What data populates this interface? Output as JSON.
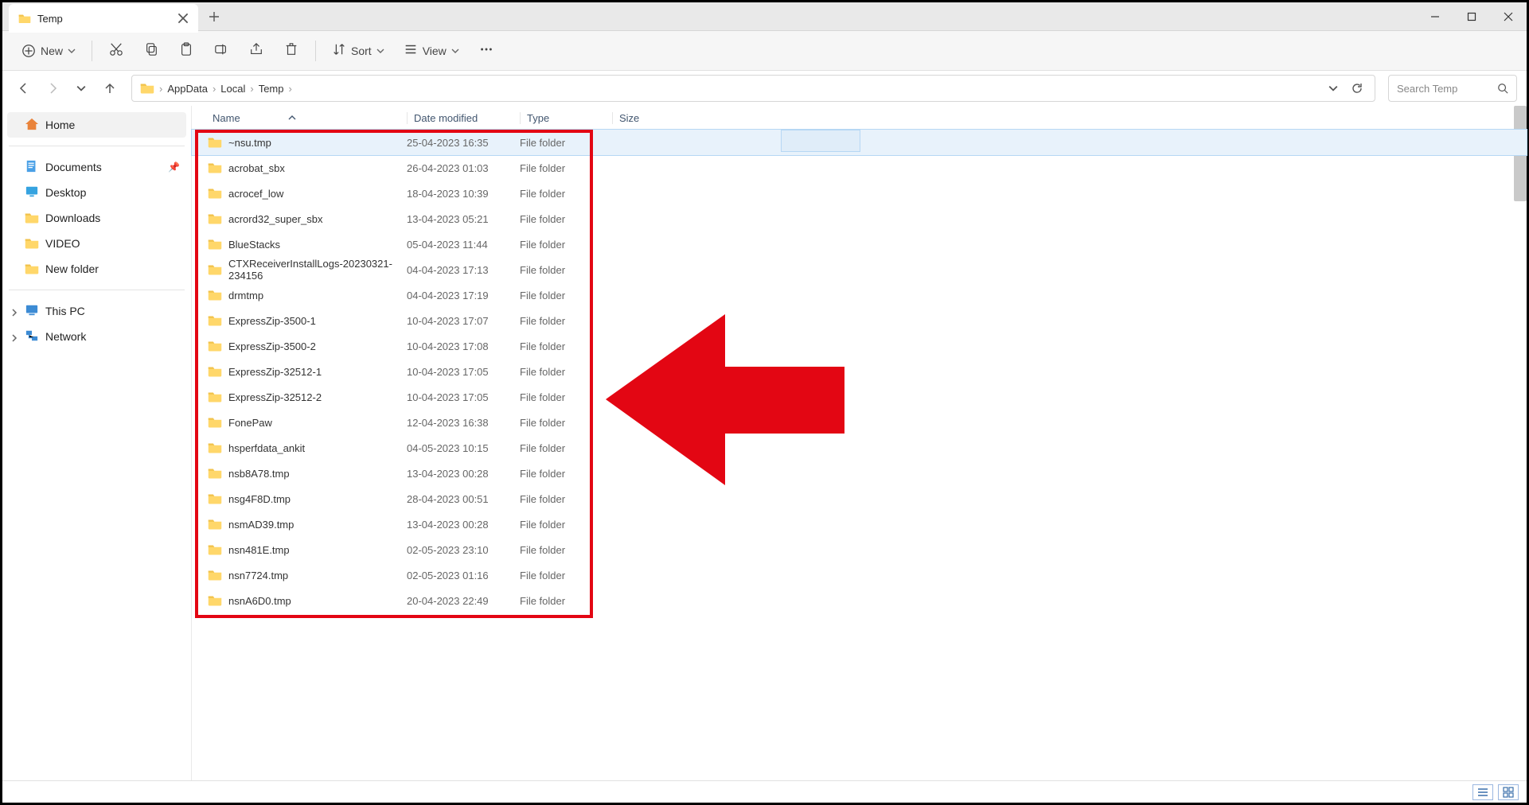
{
  "window": {
    "tab_title": "Temp"
  },
  "toolbar": {
    "new_label": "New",
    "sort_label": "Sort",
    "view_label": "View"
  },
  "breadcrumb": [
    "AppData",
    "Local",
    "Temp"
  ],
  "search": {
    "placeholder": "Search Temp"
  },
  "nav": {
    "home": "Home",
    "quick": [
      {
        "label": "Documents",
        "pinned": true,
        "icon": "doc"
      },
      {
        "label": "Desktop",
        "pinned": false,
        "icon": "desktop"
      },
      {
        "label": "Downloads",
        "pinned": false,
        "icon": "folder"
      },
      {
        "label": "VIDEO",
        "pinned": false,
        "icon": "folder"
      },
      {
        "label": "New folder",
        "pinned": false,
        "icon": "folder"
      }
    ],
    "groups": [
      {
        "label": "This PC",
        "icon": "pc"
      },
      {
        "label": "Network",
        "icon": "network"
      }
    ]
  },
  "columns": {
    "name": "Name",
    "date": "Date modified",
    "type": "Type",
    "size": "Size"
  },
  "files": [
    {
      "name": "~nsu.tmp",
      "date": "25-04-2023 16:35",
      "type": "File folder",
      "selected": true
    },
    {
      "name": "acrobat_sbx",
      "date": "26-04-2023 01:03",
      "type": "File folder"
    },
    {
      "name": "acrocef_low",
      "date": "18-04-2023 10:39",
      "type": "File folder"
    },
    {
      "name": "acrord32_super_sbx",
      "date": "13-04-2023 05:21",
      "type": "File folder"
    },
    {
      "name": "BlueStacks",
      "date": "05-04-2023 11:44",
      "type": "File folder"
    },
    {
      "name": "CTXReceiverInstallLogs-20230321-234156",
      "date": "04-04-2023 17:13",
      "type": "File folder"
    },
    {
      "name": "drmtmp",
      "date": "04-04-2023 17:19",
      "type": "File folder"
    },
    {
      "name": "ExpressZip-3500-1",
      "date": "10-04-2023 17:07",
      "type": "File folder"
    },
    {
      "name": "ExpressZip-3500-2",
      "date": "10-04-2023 17:08",
      "type": "File folder"
    },
    {
      "name": "ExpressZip-32512-1",
      "date": "10-04-2023 17:05",
      "type": "File folder"
    },
    {
      "name": "ExpressZip-32512-2",
      "date": "10-04-2023 17:05",
      "type": "File folder"
    },
    {
      "name": "FonePaw",
      "date": "12-04-2023 16:38",
      "type": "File folder"
    },
    {
      "name": "hsperfdata_ankit",
      "date": "04-05-2023 10:15",
      "type": "File folder"
    },
    {
      "name": "nsb8A78.tmp",
      "date": "13-04-2023 00:28",
      "type": "File folder"
    },
    {
      "name": "nsg4F8D.tmp",
      "date": "28-04-2023 00:51",
      "type": "File folder"
    },
    {
      "name": "nsmAD39.tmp",
      "date": "13-04-2023 00:28",
      "type": "File folder"
    },
    {
      "name": "nsn481E.tmp",
      "date": "02-05-2023 23:10",
      "type": "File folder"
    },
    {
      "name": "nsn7724.tmp",
      "date": "02-05-2023 01:16",
      "type": "File folder"
    },
    {
      "name": "nsnA6D0.tmp",
      "date": "20-04-2023 22:49",
      "type": "File folder"
    }
  ]
}
